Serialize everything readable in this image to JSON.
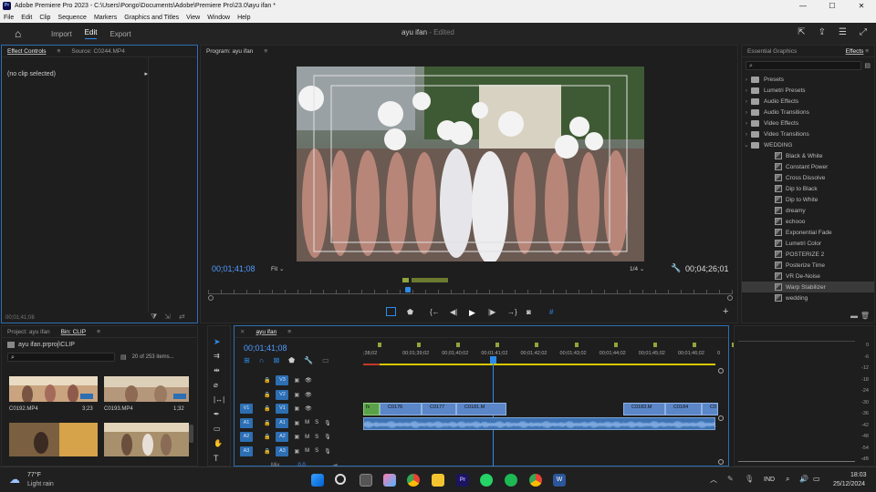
{
  "titlebar": {
    "title": "Adobe Premiere Pro 2023 - C:\\Users\\Pongo\\Documents\\Adobe\\Premiere Pro\\23.0\\ayu ifan *",
    "minimize": "—",
    "maximize": "☐",
    "close": "✕"
  },
  "menu": [
    "File",
    "Edit",
    "Clip",
    "Sequence",
    "Markers",
    "Graphics and Titles",
    "View",
    "Window",
    "Help"
  ],
  "workspace": {
    "tabs": [
      "Import",
      "Edit",
      "Export"
    ],
    "active": "Edit",
    "project_name": "ayu ifan",
    "project_status": "Edited"
  },
  "effect_controls": {
    "tab_label": "Effect Controls",
    "source_label": "Source: C0244.MP4",
    "no_clip": "(no clip selected)",
    "timecode": "00;01;41;08"
  },
  "program": {
    "title": "Program: ayu ifan",
    "timecode": "00;01;41;08",
    "fit": "Fit",
    "resolution": "1/4",
    "duration": "00;04;26;01"
  },
  "effects_panel": {
    "tab_essential": "Essential Graphics",
    "tab_effects": "Effects",
    "folders": [
      "Presets",
      "Lumetri Presets",
      "Audio Effects",
      "Audio Transitions",
      "Video Effects",
      "Video Transitions",
      "WEDDING"
    ],
    "wedding_items": [
      "Black & White",
      "Constant Power",
      "Cross Dissolve",
      "Dip to Black",
      "Dip to White",
      "dreamy",
      "echooo",
      "Exponential Fade",
      "Lumetri Color",
      "POSTERIZE 2",
      "Posterize Time",
      "VR De-Noise",
      "Warp Stabilizer",
      "wedding"
    ],
    "selected": "Warp Stabilizer"
  },
  "project_panel": {
    "tab_project": "Project: ayu ifan",
    "tab_bin": "Bin: CLIP",
    "path": "ayu ifan.prproj\\CLIP",
    "count": "20 of 253 items...",
    "thumbs": [
      {
        "name": "C0192.MP4",
        "duration": "3;23"
      },
      {
        "name": "C0193.MP4",
        "duration": "1;32"
      }
    ]
  },
  "timeline": {
    "tab": "ayu ifan",
    "timecode": "00;01;41;08",
    "ruler": [
      ";38;02",
      "00;01;39;02",
      "00;01;40;02",
      "00;01;41;02",
      "00;01;42;02",
      "00;01;43;02",
      "00;01;44;02",
      "00;01;45;02",
      "00;01;46;02",
      "0"
    ],
    "video_tracks": [
      {
        "label": "V3",
        "src": ""
      },
      {
        "label": "V2",
        "src": ""
      },
      {
        "label": "V1",
        "src": "V1"
      }
    ],
    "audio_tracks": [
      {
        "label": "A1",
        "src": "A1",
        "m": "M",
        "s": "S"
      },
      {
        "label": "A2",
        "src": "A2",
        "m": "M",
        "s": "S"
      },
      {
        "label": "A3",
        "src": "A3",
        "m": "M",
        "s": "S"
      }
    ],
    "mix_label": "Mix",
    "mix_value": "0.0",
    "clips": [
      "C0176",
      "C0177",
      "C0181.M",
      "C0183.M",
      "C0184",
      "C0"
    ],
    "fx": "fx"
  },
  "meter": {
    "labels": [
      "0",
      "-6",
      "-12",
      "-18",
      "-24",
      "-30",
      "-36",
      "-42",
      "-48",
      "-54",
      "-dB"
    ]
  },
  "taskbar": {
    "weather_temp": "77°F",
    "weather_desc": "Light rain",
    "lang": "IND",
    "time": "18:03",
    "date": "25/12/2024"
  },
  "colors": {
    "accent": "#2d8ceb",
    "timecode": "#4f9bff",
    "clip_video": "#5b86c7",
    "clip_audio": "#3d73b4",
    "playhead": "#2d8ceb"
  }
}
